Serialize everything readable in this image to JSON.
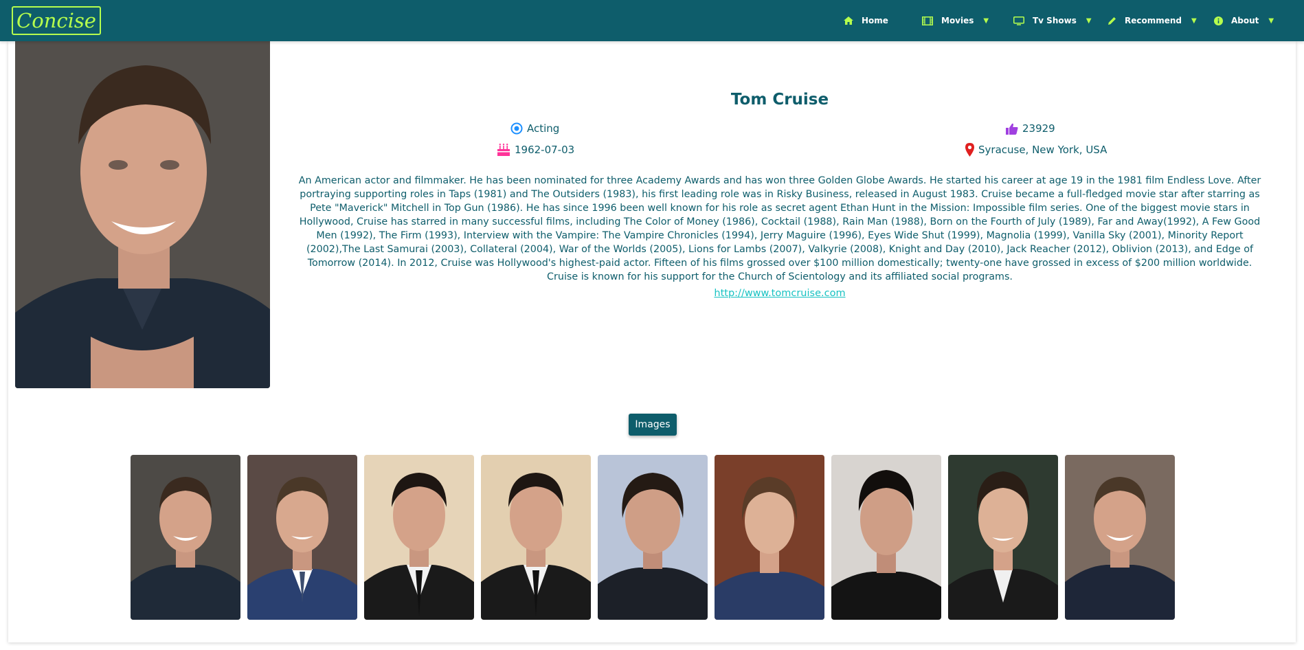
{
  "brand": {
    "name": "Concise"
  },
  "nav": {
    "home": "Home",
    "movies": "Movies",
    "tv_shows": "Tv Shows",
    "recommend": "Recommend",
    "about": "About"
  },
  "person": {
    "name": "Tom Cruise",
    "department": "Acting",
    "likes": "23929",
    "birthday": "1962-07-03",
    "place_of_birth": "Syracuse, New York, USA",
    "biography": "An American actor and filmmaker. He has been nominated for three Academy Awards and has won three Golden Globe Awards. He started his career at age 19 in the 1981 film Endless Love. After portraying supporting roles in Taps (1981) and The Outsiders (1983), his first leading role was in Risky Business, released in August 1983. Cruise became a full-fledged movie star after starring as Pete \"Maverick\" Mitchell in Top Gun (1986). He has since 1996 been well known for his role as secret agent Ethan Hunt in the Mission: Impossible film series. One of the biggest movie stars in Hollywood, Cruise has starred in many successful films, including The Color of Money (1986), Cocktail (1988), Rain Man (1988), Born on the Fourth of July (1989), Far and Away(1992), A Few Good Men (1992), The Firm (1993), Interview with the Vampire: The Vampire Chronicles (1994), Jerry Maguire (1996), Eyes Wide Shut (1999), Magnolia (1999), Vanilla Sky (2001), Minority Report (2002),The Last Samurai (2003), Collateral (2004), War of the Worlds (2005), Lions for Lambs (2007), Valkyrie (2008), Knight and Day (2010), Jack Reacher (2012), Oblivion (2013), and Edge of Tomorrow (2014). In 2012, Cruise was Hollywood's highest-paid actor. Fifteen of his films grossed over $100 million domestically; twenty-one have grossed in excess of $200 million worldwide. Cruise is known for his support for the Church of Scientology and its affiliated social programs.",
    "homepage": "http://www.tomcruise.com"
  },
  "images_section": {
    "button_label": "Images"
  },
  "colors": {
    "navbar": "#0e5d6b",
    "accent": "#b6ff4d",
    "text": "#0e5d6b",
    "link": "#17c2c2",
    "department_icon": "#1e90ff",
    "likes_icon": "#a040e0",
    "birthday_icon": "#ff3399",
    "location_icon": "#e02020"
  },
  "icons": {
    "home": "home-icon",
    "movies": "film-icon",
    "tv_shows": "tv-icon",
    "recommend": "pencil-icon",
    "about": "info-icon",
    "department": "target-icon",
    "likes": "thumbs-up-icon",
    "birthday": "birthday-cake-icon",
    "location": "map-marker-icon"
  }
}
